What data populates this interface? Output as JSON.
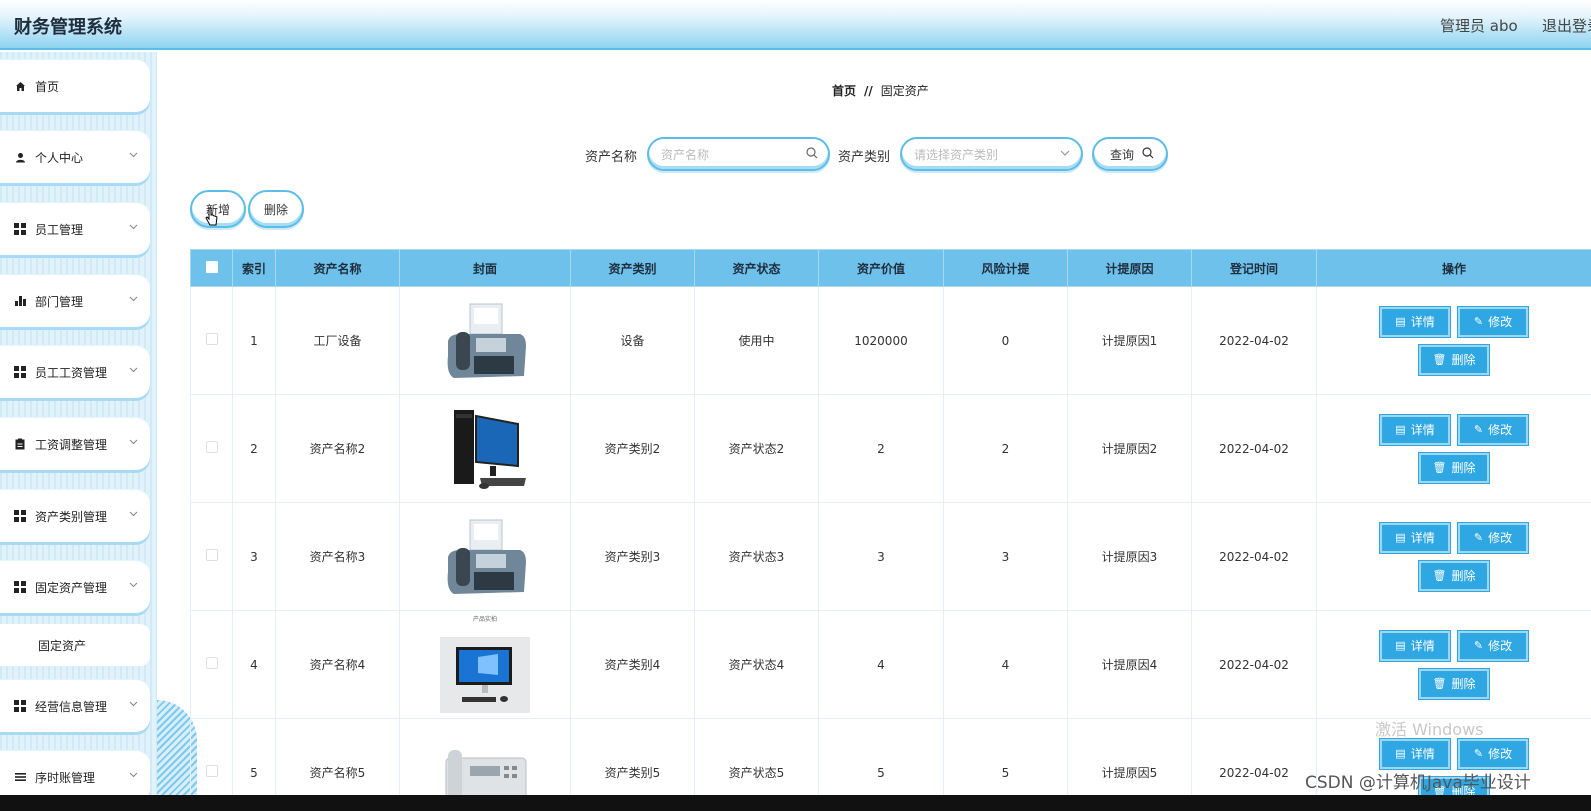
{
  "header": {
    "title": "财务管理系统",
    "user": "管理员 abo",
    "logout": "退出登录"
  },
  "sidebar": {
    "items": [
      {
        "label": "首页",
        "icon": "home-icon"
      },
      {
        "label": "个人中心",
        "icon": "user-icon"
      },
      {
        "label": "员工管理",
        "icon": "grid-icon"
      },
      {
        "label": "部门管理",
        "icon": "bar-chart-icon"
      },
      {
        "label": "员工工资管理",
        "icon": "grid-icon"
      },
      {
        "label": "工资调整管理",
        "icon": "clipboard-icon"
      },
      {
        "label": "资产类别管理",
        "icon": "grid-icon"
      },
      {
        "label": "固定资产管理",
        "icon": "grid-icon"
      },
      {
        "label": "经营信息管理",
        "icon": "grid-icon"
      },
      {
        "label": "序时账管理",
        "icon": "list-icon"
      }
    ],
    "sub_item": "固定资产"
  },
  "breadcrumb": {
    "home": "首页",
    "sep": "//",
    "current": "固定资产"
  },
  "search": {
    "name_label": "资产名称",
    "name_placeholder": "资产名称",
    "category_label": "资产类别",
    "category_placeholder": "请选择资产类别",
    "query_label": "查询"
  },
  "toolbar": {
    "add_label": "新增",
    "delete_label": "删除"
  },
  "table": {
    "headers": [
      "索引",
      "资产名称",
      "封面",
      "资产类别",
      "资产状态",
      "资产价值",
      "风险计提",
      "计提原因",
      "登记时间",
      "操作"
    ],
    "rows": [
      {
        "index": "1",
        "name": "工厂设备",
        "image": "fax-machine",
        "category": "设备",
        "status": "使用中",
        "value": "1020000",
        "risk": "0",
        "reason": "计提原因1",
        "date": "2022-04-02"
      },
      {
        "index": "2",
        "name": "资产名称2",
        "image": "desktop-computer",
        "category": "资产类别2",
        "status": "资产状态2",
        "value": "2",
        "risk": "2",
        "reason": "计提原因2",
        "date": "2022-04-02"
      },
      {
        "index": "3",
        "name": "资产名称3",
        "image": "fax-machine",
        "category": "资产类别3",
        "status": "资产状态3",
        "value": "3",
        "risk": "3",
        "reason": "计提原因3",
        "date": "2022-04-02"
      },
      {
        "index": "4",
        "name": "资产名称4",
        "image": "all-in-one-pc",
        "category": "资产类别4",
        "status": "资产状态4",
        "value": "4",
        "risk": "4",
        "reason": "计提原因4",
        "date": "2022-04-02"
      },
      {
        "index": "5",
        "name": "资产名称5",
        "image": "fax-phone",
        "category": "资产类别5",
        "status": "资产状态5",
        "value": "5",
        "risk": "5",
        "reason": "计提原因5",
        "date": "2022-04-02"
      }
    ],
    "actions": {
      "detail": "详情",
      "edit": "修改",
      "delete": "删除"
    },
    "image_caption_4": "产品实拍"
  },
  "watermark": {
    "windows": "激活 Windows",
    "csdn": "CSDN @计算机Java毕业设计"
  },
  "colors": {
    "accent": "#2fa7e3",
    "header_blue": "#8fd3f1",
    "table_header": "#6ec1ea"
  }
}
